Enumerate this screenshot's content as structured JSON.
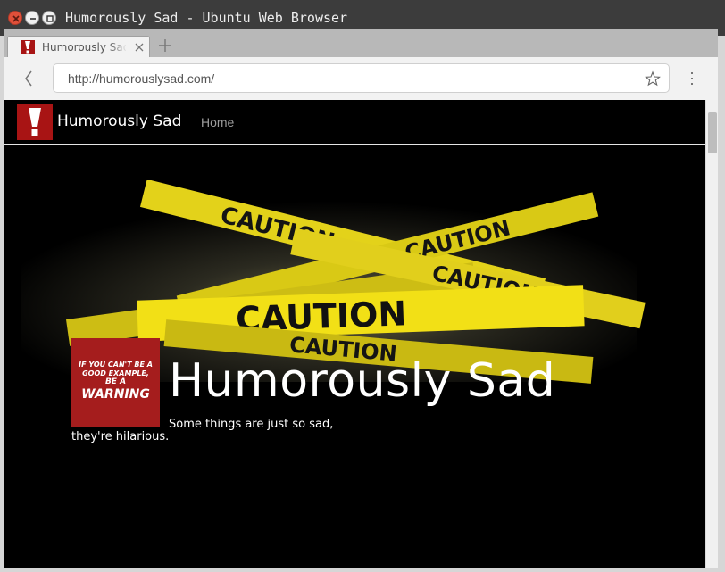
{
  "window": {
    "title": "Humorously Sad - Ubuntu Web Browser"
  },
  "tabs": [
    {
      "title": "Humorously Sad",
      "favicon": "exclamation-icon",
      "active": true
    }
  ],
  "toolbar": {
    "url": "http://humorouslysad.com/"
  },
  "site": {
    "brand": "Humorously Sad",
    "nav": [
      {
        "label": "Home"
      }
    ],
    "hero": {
      "title": "Humorously Sad",
      "tagline_line1": "Some things are just so sad,",
      "tagline_line2": "they're hilarious.",
      "tape_text": "CAUTION",
      "sign": {
        "line1": "IF YOU CAN'T BE A",
        "line2": "GOOD EXAMPLE,",
        "line3": "BE A",
        "line4": "WARNING"
      }
    }
  },
  "colors": {
    "brand_red": "#a81414",
    "tape_yellow": "#f2e016",
    "page_bg": "#000000",
    "nav_link": "#9d9d9d"
  }
}
